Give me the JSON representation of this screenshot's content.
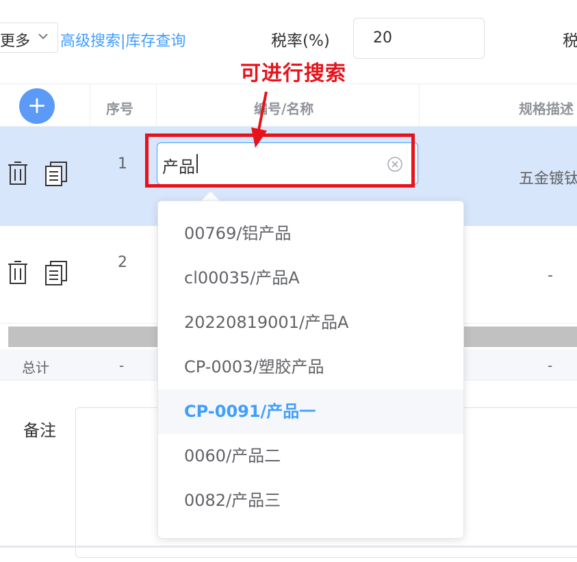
{
  "toolbar": {
    "more_label": "更多",
    "advanced_link": "高级搜索|库存查询",
    "tax_rate_label": "税率(%)",
    "tax_rate_value": "20",
    "tax_label_cut": "税"
  },
  "annotation": {
    "text": "可进行搜索",
    "color": "#e6131b"
  },
  "table": {
    "headers": {
      "index": "序号",
      "code_name": "编号/名称",
      "spec": "规格描述"
    },
    "rows": [
      {
        "index": "1",
        "code_value": "产品",
        "spec": "五金镀钛"
      },
      {
        "index": "2",
        "spec": "-"
      }
    ],
    "total": {
      "label": "总计",
      "index": "-",
      "spec": "-"
    }
  },
  "dropdown": {
    "options": [
      "00769/铝产品",
      "cl00035/产品A",
      "20220819001/产品A",
      "CP-0003/塑胶产品",
      "CP-0091/产品一",
      "0060/产品二",
      "0082/产品三"
    ],
    "selected_index": 4
  },
  "remark": {
    "label": "备注"
  },
  "colors": {
    "accent": "#409eff",
    "row_highlight": "#d8e6fb",
    "add_button": "#5b9bf7"
  }
}
